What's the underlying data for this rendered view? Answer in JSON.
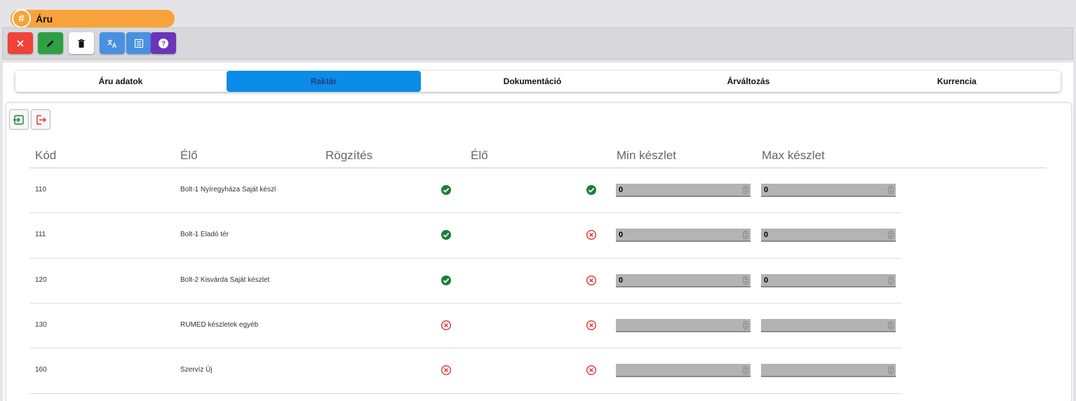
{
  "window": {
    "title": "Áru",
    "title_icon": "hash-icon"
  },
  "toolbar": {
    "buttons": [
      {
        "name": "close-button",
        "icon": "close-icon",
        "color": "#f0433a"
      },
      {
        "name": "edit-button",
        "icon": "pencil-icon",
        "color": "#2ea043"
      },
      {
        "name": "delete-button",
        "icon": "trash-icon",
        "color": "#ffffff"
      },
      {
        "name": "translate-button",
        "icon": "translate-icon",
        "color": "#4a90e2"
      },
      {
        "name": "list-button",
        "icon": "list-icon",
        "color": "#4a90e2"
      },
      {
        "name": "help-button",
        "icon": "question-icon",
        "color": "#6a35b8"
      }
    ]
  },
  "tabs": [
    {
      "label": "Áru adatok",
      "active": false
    },
    {
      "label": "Raktár",
      "active": true
    },
    {
      "label": "Dokumentáció",
      "active": false
    },
    {
      "label": "Árváltozás",
      "active": false
    },
    {
      "label": "Kurrencia",
      "active": false
    }
  ],
  "actions": {
    "import_icon": "login-icon",
    "export_icon": "logout-icon"
  },
  "table": {
    "headers": [
      "Kód",
      "Élő",
      "Rögzítés",
      "Élő",
      "Min készlet",
      "Max készlet"
    ],
    "rows": [
      {
        "kod": "110",
        "nev": "Bolt-1 Nyíregyháza Saját készl",
        "rogzites": true,
        "elo": true,
        "min": "0",
        "max": "0"
      },
      {
        "kod": "111",
        "nev": "Bolt-1 Eladó tér",
        "rogzites": true,
        "elo": false,
        "min": "0",
        "max": "0"
      },
      {
        "kod": "120",
        "nev": "Bolt-2 Kisvárda Saját készlet",
        "rogzites": true,
        "elo": false,
        "min": "0",
        "max": "0"
      },
      {
        "kod": "130",
        "nev": "RUMED készletek egyéb",
        "rogzites": false,
        "elo": false,
        "min": "",
        "max": ""
      },
      {
        "kod": "160",
        "nev": "Szervíz Új",
        "rogzites": false,
        "elo": false,
        "min": "",
        "max": ""
      }
    ]
  },
  "colors": {
    "accent": "#0a8ce8",
    "title": "#f7a33a",
    "ok": "#1a7f37",
    "no": "#e0323a"
  }
}
